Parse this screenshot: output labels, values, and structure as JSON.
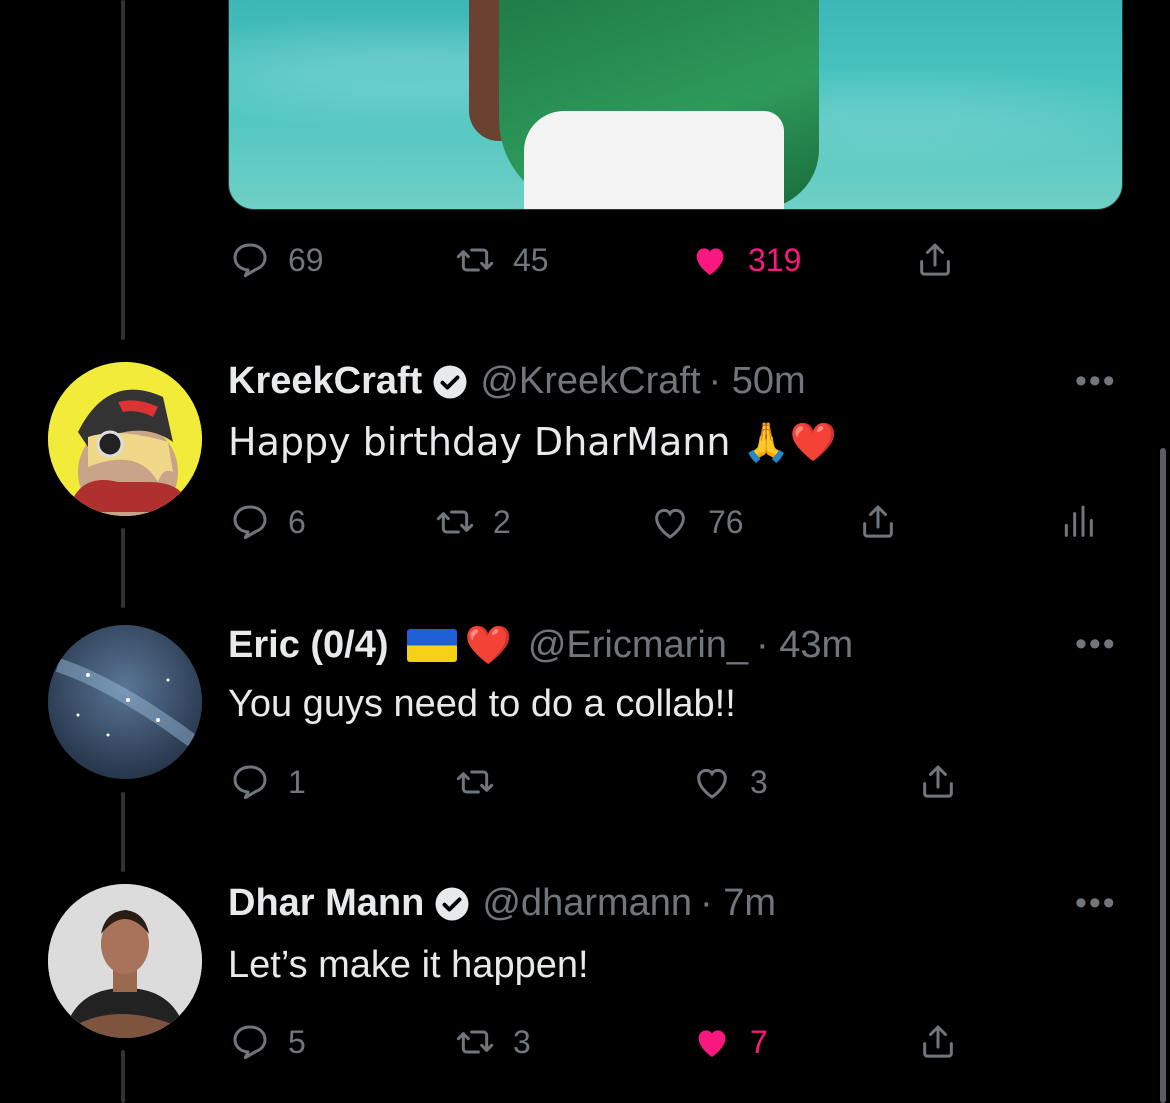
{
  "colors": {
    "background": "#000000",
    "text": "#e7e9ea",
    "muted": "#71767b",
    "like": "#f91880"
  },
  "top_post": {
    "reply_count": "69",
    "retweet_count": "45",
    "like_count": "319",
    "liked": true
  },
  "replies": [
    {
      "name": "KreekCraft",
      "verified": true,
      "handle": "@KreekCraft",
      "time": "· 50m",
      "text": "Happy birthday DharMann 🙏❤️",
      "reply_count": "6",
      "retweet_count": "2",
      "like_count": "76",
      "liked": false
    },
    {
      "name": "Eric (0/4)",
      "name_emoji": "❤️",
      "handle": "@Ericmarin_",
      "time": "· 43m",
      "text": "You guys need to do a collab!!",
      "reply_count": "1",
      "retweet_count": "",
      "like_count": "3",
      "liked": false
    },
    {
      "name": "Dhar Mann",
      "verified": true,
      "handle": "@dharmann",
      "time": "· 7m",
      "text": "Let’s make it happen!",
      "reply_count": "5",
      "retweet_count": "3",
      "like_count": "7",
      "liked": true
    }
  ],
  "icons": [
    "reply-icon",
    "retweet-icon",
    "like-icon",
    "share-icon",
    "analytics-icon",
    "verified-badge-icon",
    "more-icon"
  ]
}
